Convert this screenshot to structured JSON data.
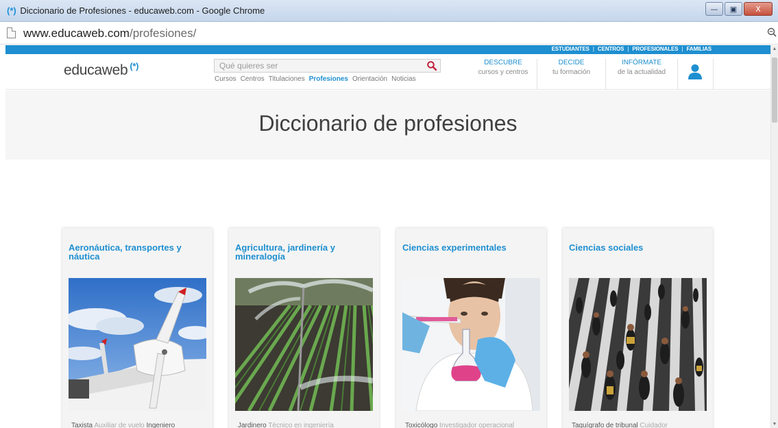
{
  "window": {
    "title_icon": "(*)",
    "title": "Diccionario de Profesiones - educaweb.com - Google Chrome",
    "minimize": "—",
    "maximize": "▣",
    "close": "X"
  },
  "address_bar": {
    "host": "www.educaweb.com",
    "path": "/profesiones/"
  },
  "site": {
    "top_links": [
      "ESTUDIANTES",
      "CENTROS",
      "PROFESIONALES",
      "FAMILIAS"
    ],
    "logo_text": "educaweb",
    "logo_mark": "(*)",
    "search_placeholder": "Qué quieres ser",
    "subnav": [
      "Cursos",
      "Centros",
      "Titulaciones",
      "Profesiones",
      "Orientación",
      "Noticias"
    ],
    "subnav_active": "Profesiones",
    "header_links": [
      {
        "title": "DESCUBRE",
        "subtitle": "cursos y centros"
      },
      {
        "title": "DECIDE",
        "subtitle": "tu formación"
      },
      {
        "title": "INFÓRMATE",
        "subtitle": "de la actualidad"
      }
    ],
    "page_title": "Diccionario de profesiones",
    "accent_color": "#1e8fd0"
  },
  "cards": [
    {
      "title": "Aeronáutica, transportes y náutica",
      "jobs_bold": "Taxista",
      "jobs_rest": "Auxiliar de vuelo",
      "jobs_bold2": "Ingeniero",
      "image": "airplane-propeller"
    },
    {
      "title": "Agricultura, jardinería y mineralogía",
      "jobs_bold": "Jardinero",
      "jobs_rest": "Técnico en ingeniería",
      "jobs_bold2": "",
      "image": "irrigated-field"
    },
    {
      "title": "Ciencias experimentales",
      "jobs_bold": "Toxicólogo",
      "jobs_rest": "Investigador operacional",
      "jobs_bold2": "",
      "image": "scientist-flask"
    },
    {
      "title": "Ciencias sociales",
      "jobs_bold": "Taquígrafo de tribunal",
      "jobs_rest": "Cuidador",
      "jobs_bold2": "",
      "image": "crowd-crosswalk"
    }
  ]
}
